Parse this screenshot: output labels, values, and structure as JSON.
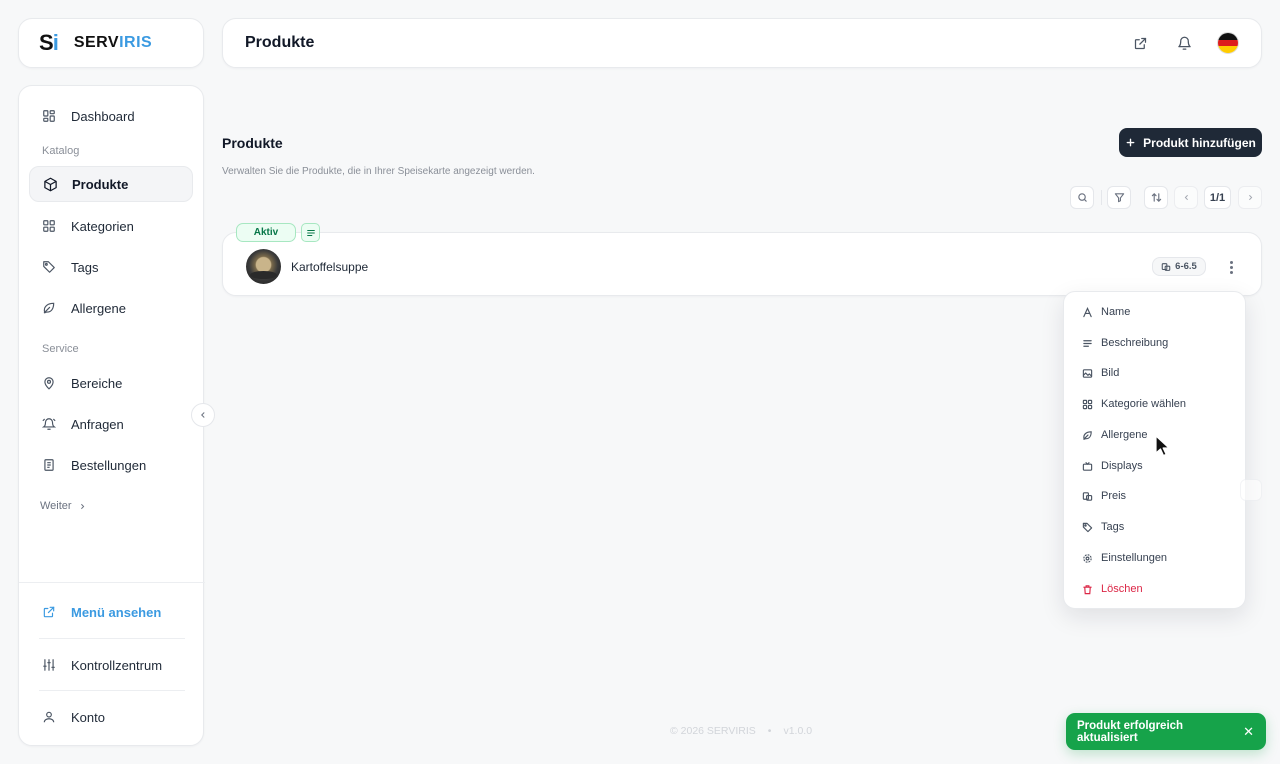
{
  "brand": {
    "mark": "S",
    "mark_accent": "i",
    "name_a": "SERV",
    "name_b": "IRIS"
  },
  "header": {
    "title": "Produkte"
  },
  "sidebar": {
    "dashboard": "Dashboard",
    "section_catalog": "Katalog",
    "produkte": "Produkte",
    "kategorien": "Kategorien",
    "tags": "Tags",
    "allergene": "Allergene",
    "section_service": "Service",
    "bereiche": "Bereiche",
    "anfragen": "Anfragen",
    "bestellungen": "Bestellungen",
    "weiter": "Weiter",
    "menu_ansehen": "Menü ansehen",
    "kontrollzentrum": "Kontrollzentrum",
    "konto": "Konto"
  },
  "main": {
    "heading": "Produkte",
    "description": "Verwalten Sie die Produkte, die in Ihrer Speisekarte angezeigt werden.",
    "add_button": "Produkt hinzufügen",
    "pager": "1/1"
  },
  "product": {
    "status": "Aktiv",
    "name": "Kartoffelsuppe",
    "price": "6-6.5"
  },
  "menu": {
    "name": "Name",
    "beschreibung": "Beschreibung",
    "bild": "Bild",
    "kategorie": "Kategorie wählen",
    "allergene": "Allergene",
    "displays": "Displays",
    "preis": "Preis",
    "tags": "Tags",
    "einstellungen": "Einstellungen",
    "loeschen": "Löschen"
  },
  "footer": {
    "copyright": "© 2026 SERVIRIS",
    "dot": "•",
    "version": "v1.0.0"
  },
  "toast": {
    "message": "Produkt erfolgreich aktualisiert",
    "close": "✕"
  },
  "colors": {
    "accent": "#3b9ae1",
    "primary_button": "#1f2937",
    "success": "#16a34a",
    "danger": "#dc2646"
  }
}
